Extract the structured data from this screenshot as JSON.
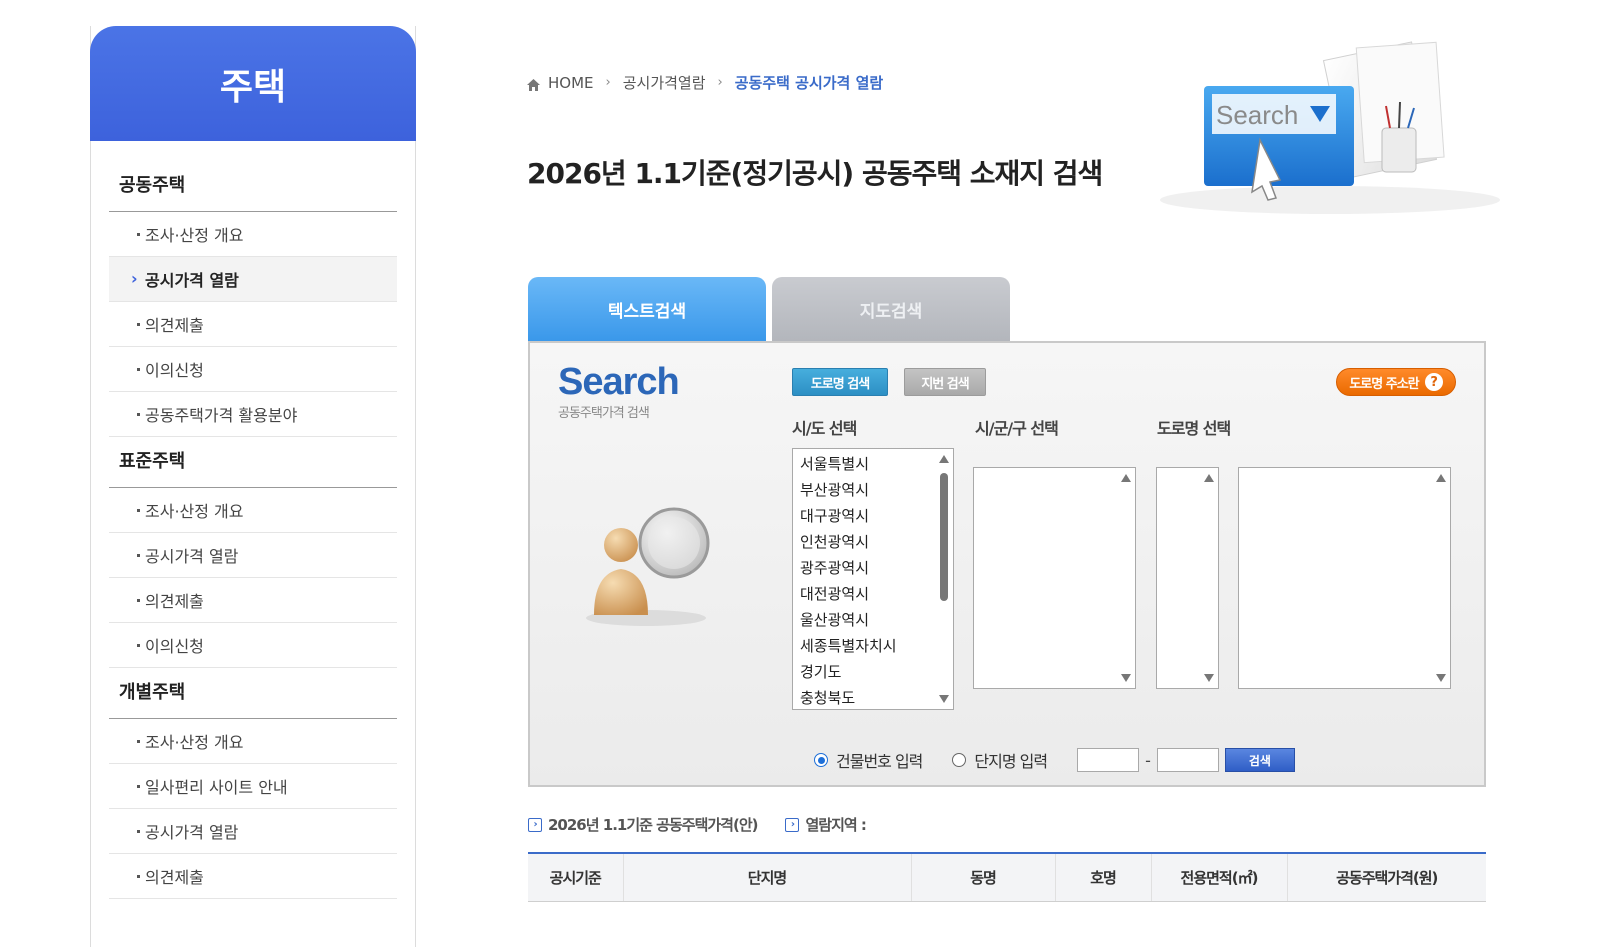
{
  "sidebar": {
    "title": "주택",
    "groups": [
      {
        "title": "공동주택",
        "items": [
          "조사·산정 개요",
          "공시가격 열람",
          "의견제출",
          "이의신청",
          "공동주택가격 활용분야"
        ]
      },
      {
        "title": "표준주택",
        "items": [
          "조사·산정 개요",
          "공시가격 열람",
          "의견제출",
          "이의신청"
        ]
      },
      {
        "title": "개별주택",
        "items": [
          "조사·산정 개요",
          "일사편리 사이트 안내",
          "공시가격 열람",
          "의견제출"
        ]
      }
    ]
  },
  "breadcrumb": {
    "home": "HOME",
    "level1": "공시가격열람",
    "current": "공동주택 공시가격 열람"
  },
  "page_title": "2026년 1.1기준(정기공시) 공동주택 소재지 검색",
  "hero": {
    "search_text": "Search"
  },
  "tabs": {
    "text_search": "텍스트검색",
    "map_search": "지도검색"
  },
  "panel": {
    "brand_title": "Search",
    "brand_subtitle": "공동주택가격 검색",
    "road_search": "도로명 검색",
    "lot_search": "지번 검색",
    "help_button": "도로명 주소란",
    "help_q": "?",
    "labels": {
      "sido": "시/도 선택",
      "sigungu": "시/군/구 선택",
      "road": "도로명 선택"
    },
    "sido_options": [
      "서울특별시",
      "부산광역시",
      "대구광역시",
      "인천광역시",
      "광주광역시",
      "대전광역시",
      "울산광역시",
      "세종특별자치시",
      "경기도",
      "충청북도"
    ],
    "radio_building": "건물번호 입력",
    "radio_complex": "단지명 입력",
    "dash": "-",
    "search_button": "검색"
  },
  "info": {
    "price_link": "2026년 1.1기준 공동주택가격(안)",
    "region_link": "열람지역 :"
  },
  "table": {
    "headers": [
      "공시기준",
      "단지명",
      "동명",
      "호명",
      "전용면적(㎡)",
      "공동주택가격(원)"
    ]
  },
  "colors": {
    "accent": "#3d62dc",
    "tab_active": "#3a98ea",
    "help_orange": "#ea6a00"
  }
}
